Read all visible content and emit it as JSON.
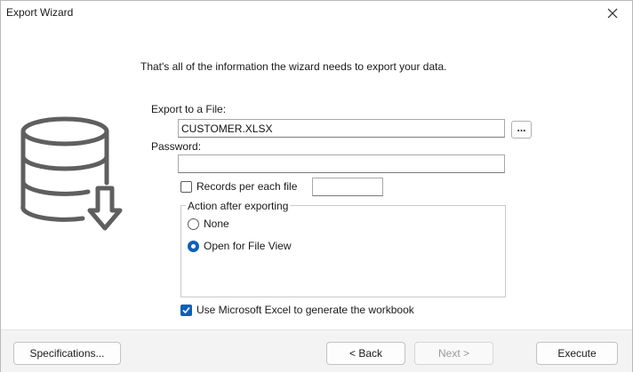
{
  "window": {
    "title": "Export Wizard"
  },
  "intro_text": "That's all of the information the wizard needs to export your data.",
  "form": {
    "export_file_label": "Export to a File:",
    "export_file_value": "CUSTOMER.XLSX",
    "browse_label": "...",
    "password_label": "Password:",
    "password_value": "",
    "records_per_file_label": "Records per each file",
    "records_per_file_checked": false,
    "records_per_file_value": ""
  },
  "action_group": {
    "legend": "Action after exporting",
    "options": [
      {
        "label": "None",
        "selected": false
      },
      {
        "label": "Open for File View",
        "selected": true
      }
    ]
  },
  "use_excel": {
    "label": "Use Microsoft Excel to generate the workbook",
    "checked": true
  },
  "buttons": {
    "specifications": "Specifications...",
    "back": "< Back",
    "next": "Next >",
    "execute": "Execute"
  },
  "icons": {
    "close": "close-icon",
    "database_export": "database-export-icon",
    "checkmark": "checkmark-icon"
  },
  "colors": {
    "accent": "#0f5fb8",
    "footer_bg": "#f3f3f3",
    "icon_gray": "#5f5f5f"
  }
}
